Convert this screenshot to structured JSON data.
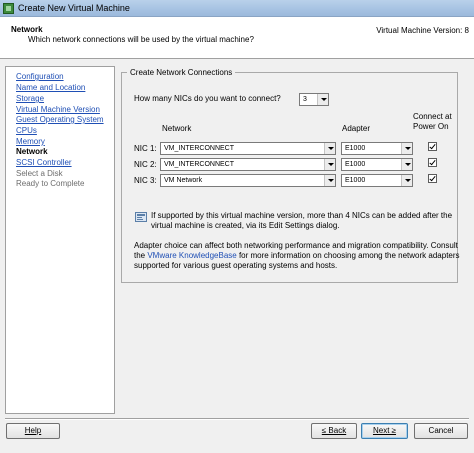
{
  "window": {
    "title": "Create New Virtual Machine"
  },
  "header": {
    "title": "Network",
    "subtitle": "Which network connections will be used by the virtual machine?",
    "version": "Virtual Machine Version: 8"
  },
  "nav": {
    "items": [
      {
        "label": "Configuration",
        "state": "link"
      },
      {
        "label": "Name and Location",
        "state": "link"
      },
      {
        "label": "Storage",
        "state": "link"
      },
      {
        "label": "Virtual Machine Version",
        "state": "link"
      },
      {
        "label": "Guest Operating System",
        "state": "link"
      },
      {
        "label": "CPUs",
        "state": "link"
      },
      {
        "label": "Memory",
        "state": "link"
      },
      {
        "label": "Network",
        "state": "current"
      },
      {
        "label": "SCSI Controller",
        "state": "link"
      },
      {
        "label": "Select a Disk",
        "state": "disabled"
      },
      {
        "label": "Ready to Complete",
        "state": "disabled"
      }
    ]
  },
  "panel": {
    "legend": "Create Network Connections",
    "nic_count_label": "How many NICs do you want to connect?",
    "nic_count_value": "3",
    "col_network": "Network",
    "col_adapter": "Adapter",
    "col_connect_line1": "Connect at",
    "col_connect_line2": "Power On",
    "nics": [
      {
        "label": "NIC 1:",
        "network": "VM_INTERCONNECT",
        "adapter": "E1000",
        "connect": true
      },
      {
        "label": "NIC 2:",
        "network": "VM_INTERCONNECT",
        "adapter": "E1000",
        "connect": true
      },
      {
        "label": "NIC 3:",
        "network": "VM Network",
        "adapter": "E1000",
        "connect": true
      }
    ],
    "info_line1": "If supported by this virtual machine version, more than 4 NICs can be added after the",
    "info_line2": "virtual machine is created, via its Edit Settings dialog.",
    "adapter_line1": "Adapter choice can affect both networking performance and migration compatibility. Consult",
    "adapter_line2_pre": "the ",
    "adapter_line2_link": "VMware KnowledgeBase",
    "adapter_line2_post": " for more information on choosing among the network adapters",
    "adapter_line3": "supported for various guest operating systems and hosts."
  },
  "buttons": {
    "help": "Help",
    "back": "≤ Back",
    "next": "Next ≥",
    "cancel": "Cancel"
  },
  "icons": {
    "app": "vm-icon",
    "info": "info-icon",
    "dropdown": "chevron-down-icon",
    "check": "check-icon"
  }
}
